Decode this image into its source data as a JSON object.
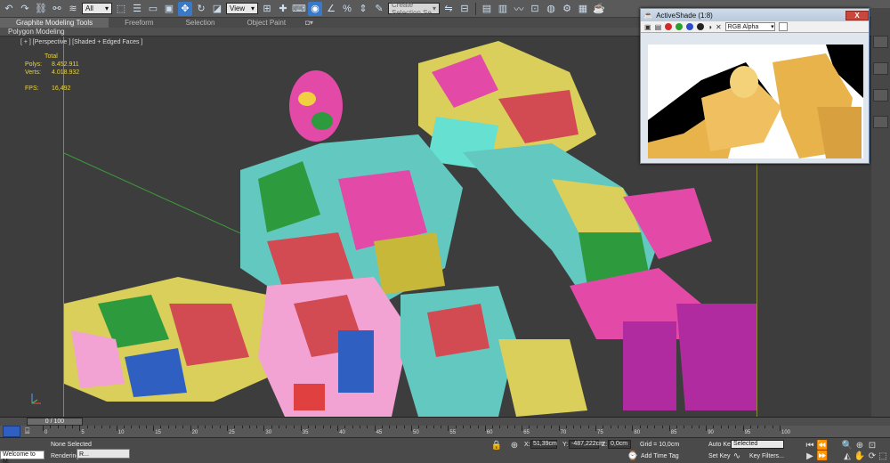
{
  "toolbar": {
    "selection_filter": "All",
    "ref_coord": "View",
    "named_selection_placeholder": "Create Selection Se"
  },
  "ribbon": {
    "tabs": [
      {
        "label": "Graphite Modeling Tools"
      },
      {
        "label": "Freeform"
      },
      {
        "label": "Selection"
      },
      {
        "label": "Object Paint"
      }
    ],
    "active_panel": "Polygon Modeling"
  },
  "viewport": {
    "label": "[ + ] [Perspective ] [Shaded + Edged Faces ]",
    "stats": {
      "total_label": "Total",
      "polys_label": "Polys:",
      "polys_value": "8.452.911",
      "verts_label": "Verts:",
      "verts_value": "4.018.932",
      "fps_label": "FPS:",
      "fps_value": "16,492"
    }
  },
  "activeshade": {
    "title": "ActiveShade (1:8)",
    "channel": "RGB Alpha",
    "close_label": "X"
  },
  "timeline": {
    "frame_readout": "0 / 100",
    "ticks": [
      "0",
      "5",
      "10",
      "15",
      "20",
      "25",
      "30",
      "35",
      "40",
      "45",
      "50",
      "55",
      "60",
      "65",
      "70",
      "75",
      "80",
      "85",
      "90",
      "95",
      "100"
    ]
  },
  "status": {
    "selection": "None Selected",
    "prompt": "Rendering",
    "script_listener": "Welcome to M:",
    "x_label": "X:",
    "x_value": "51,39cm",
    "y_label": "Y:",
    "y_value": "-487,222cm",
    "z_label": "Z:",
    "z_value": "0,0cm",
    "grid": "Grid = 10,0cm",
    "auto_key": "Auto Key",
    "set_key": "Set Key",
    "key_mode": "Selected",
    "key_filters": "Key Filters...",
    "add_time_tag": "Add Time Tag",
    "taskbar_item": "R..."
  },
  "colors": {
    "active_blue": "#3a78c8",
    "stats_yellow": "#e7d34a",
    "close_red": "#c9473b"
  }
}
